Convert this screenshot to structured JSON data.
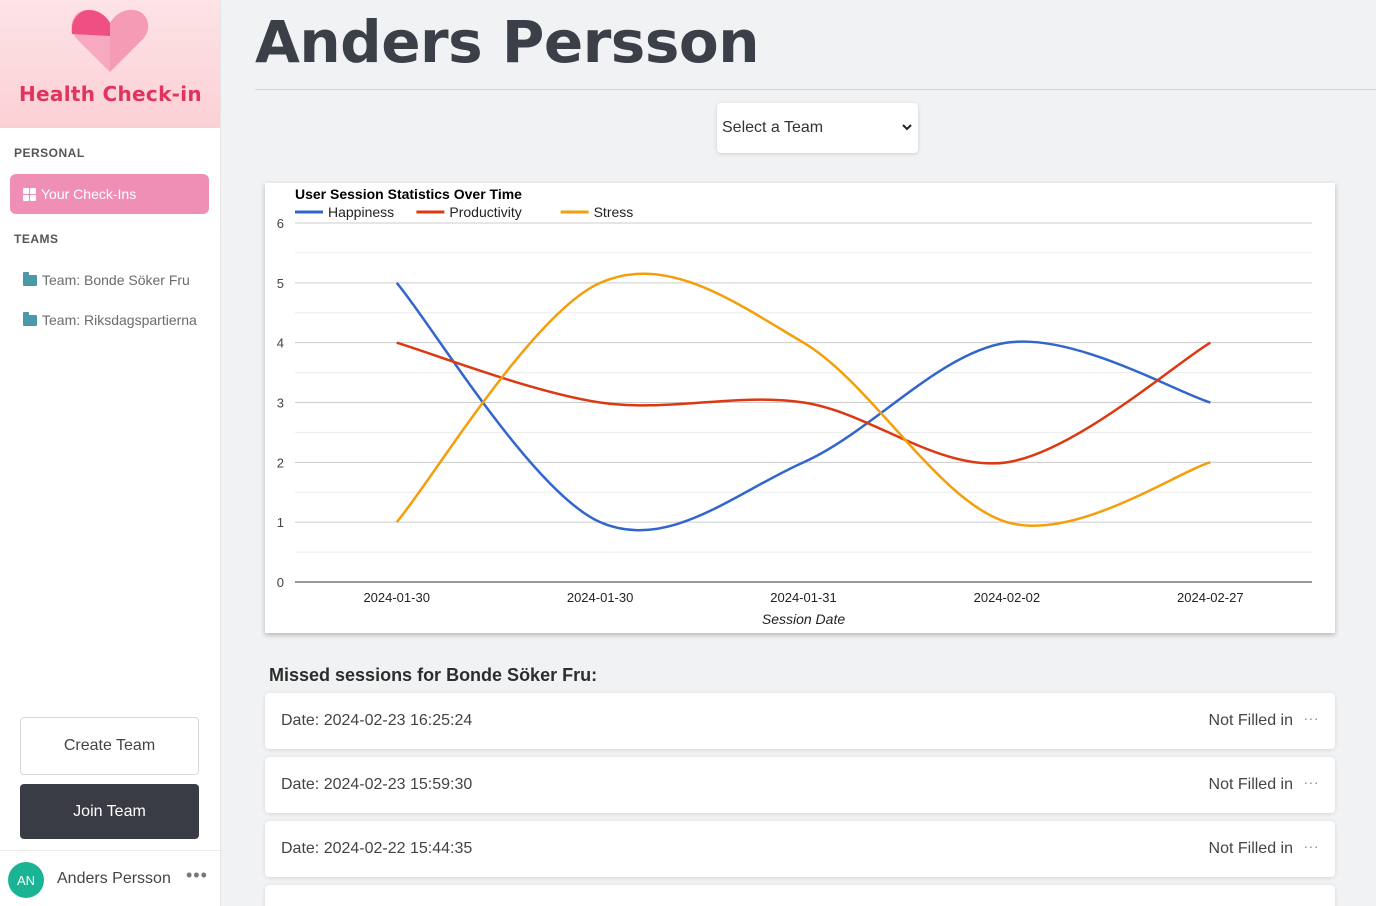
{
  "app": {
    "title": "Health Check-in"
  },
  "sidebar": {
    "personal_label": "PERSONAL",
    "active_item": "Your Check-Ins",
    "teams_label": "TEAMS",
    "teams": [
      "Team: Bonde Söker Fru",
      "Team: Riksdagspartierna"
    ],
    "create_team": "Create Team",
    "join_team": "Join Team",
    "user": {
      "initials": "AN",
      "name": "Anders Persson",
      "more": "•••"
    }
  },
  "main": {
    "title": "Anders Persson",
    "team_select": {
      "value": "Select a Team",
      "chevron": "⌄"
    },
    "missed_title": "Missed sessions for Bonde Söker Fru:",
    "sessions": [
      {
        "date": "Date: 2024-02-23 16:25:24",
        "status": "Not Filled in",
        "more": "···"
      },
      {
        "date": "Date: 2024-02-23 15:59:30",
        "status": "Not Filled in",
        "more": "···"
      },
      {
        "date": "Date: 2024-02-22 15:44:35",
        "status": "Not Filled in",
        "more": "···"
      }
    ]
  },
  "chart_data": {
    "type": "line",
    "title": "User Session Statistics Over Time",
    "xlabel": "Session Date",
    "ylabel": "",
    "categories": [
      "2024-01-30",
      "2024-01-30",
      "2024-01-31",
      "2024-02-02",
      "2024-02-27"
    ],
    "ylim": [
      0,
      6
    ],
    "yticks": [
      0,
      1,
      2,
      3,
      4,
      5,
      6
    ],
    "grid": true,
    "legend": "top-left",
    "series": [
      {
        "name": "Happiness",
        "color": "#3366cc",
        "values": [
          5,
          1,
          2,
          4,
          3
        ]
      },
      {
        "name": "Productivity",
        "color": "#dc3912",
        "values": [
          4,
          3,
          3,
          2,
          4
        ]
      },
      {
        "name": "Stress",
        "color": "#f59e0b",
        "values": [
          1,
          5,
          4,
          1,
          2
        ]
      }
    ]
  }
}
